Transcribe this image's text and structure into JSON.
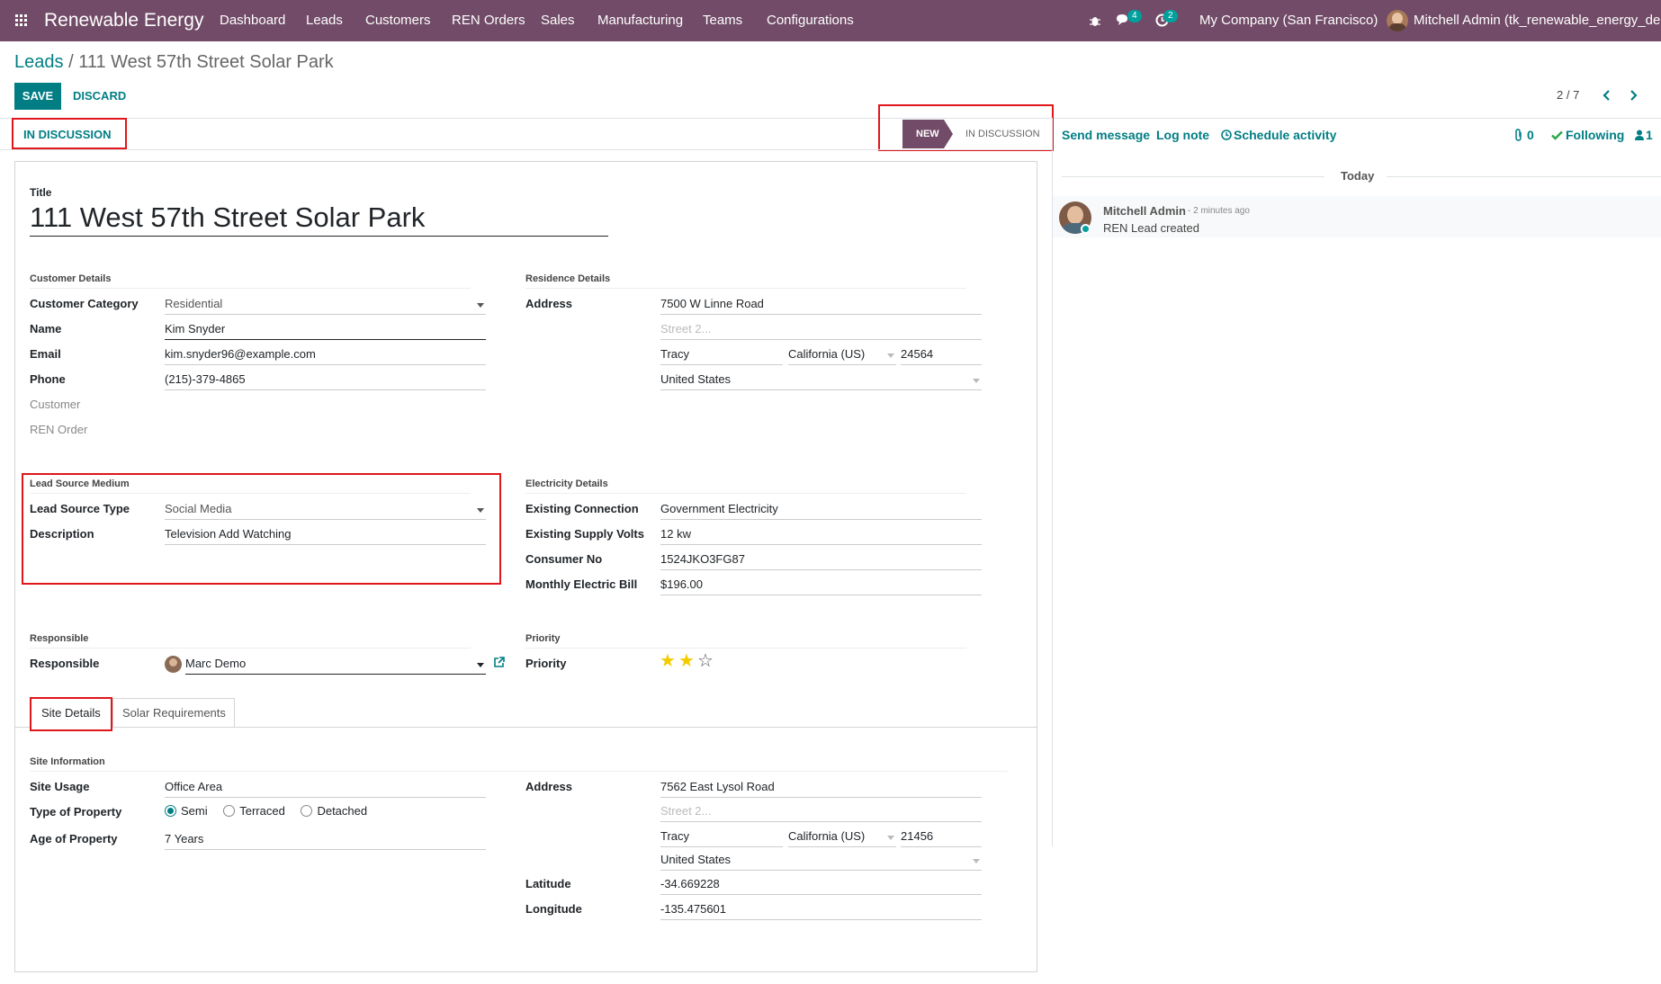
{
  "nav": {
    "app_name": "Renewable Energy",
    "menu": [
      "Dashboard",
      "Leads",
      "Customers",
      "REN Orders",
      "Sales",
      "Manufacturing",
      "Teams",
      "Configurations"
    ],
    "messages_count": "4",
    "activities_count": "2",
    "company": "My Company (San Francisco)",
    "user": "Mitchell Admin (tk_renewable_energy_demo)"
  },
  "breadcrumb": {
    "parent": "Leads",
    "separator": "/",
    "current": "111 West 57th Street Solar Park"
  },
  "toolbar": {
    "save_label": "SAVE",
    "discard_label": "DISCARD",
    "pager": "2 / 7"
  },
  "status": {
    "current_label": "IN DISCUSSION",
    "stages": [
      "NEW",
      "IN DISCUSSION"
    ],
    "active_stage": "NEW"
  },
  "form": {
    "title_label": "Title",
    "title": "111 West 57th Street Solar Park",
    "customer_details": {
      "section": "Customer Details",
      "category_label": "Customer Category",
      "category": "Residential",
      "name_label": "Name",
      "name": "Kim Snyder",
      "email_label": "Email",
      "email": "kim.snyder96@example.com",
      "phone_label": "Phone",
      "phone": "(215)-379-4865",
      "customer_label": "Customer",
      "ren_order_label": "REN Order"
    },
    "residence_details": {
      "section": "Residence Details",
      "address_label": "Address",
      "street": "7500 W Linne Road",
      "street2_placeholder": "Street 2...",
      "city": "Tracy",
      "state": "California (US)",
      "zip": "24564",
      "country": "United States"
    },
    "lead_source": {
      "section": "Lead Source Medium",
      "type_label": "Lead Source Type",
      "type": "Social Media",
      "description_label": "Description",
      "description": "Television Add Watching"
    },
    "electricity": {
      "section": "Electricity Details",
      "connection_label": "Existing Connection",
      "connection": "Government Electricity",
      "volts_label": "Existing Supply Volts",
      "volts": "12 kw",
      "consumer_label": "Consumer No",
      "consumer": "1524JKO3FG87",
      "bill_label": "Monthly Electric Bill",
      "bill": "$196.00"
    },
    "responsible": {
      "section": "Responsible",
      "label": "Responsible",
      "value": "Marc Demo"
    },
    "priority": {
      "section": "Priority",
      "label": "Priority",
      "stars": 2,
      "max": 3
    },
    "tabs": [
      "Site Details",
      "Solar Requirements"
    ],
    "site": {
      "section": "Site Information",
      "usage_label": "Site Usage",
      "usage": "Office Area",
      "type_label": "Type of Property",
      "type_options": [
        "Semi",
        "Terraced",
        "Detached"
      ],
      "type_selected": "Semi",
      "age_label": "Age of Property",
      "age": "7 Years",
      "address_label": "Address",
      "street": "7562 East Lysol Road",
      "street2_placeholder": "Street 2...",
      "city": "Tracy",
      "state": "California (US)",
      "zip": "21456",
      "country": "United States",
      "lat_label": "Latitude",
      "lat": "-34.669228",
      "long_label": "Longitude",
      "long": "-135.475601"
    }
  },
  "chatter": {
    "send_message": "Send message",
    "log_note": "Log note",
    "schedule_activity": "Schedule activity",
    "attachments": "0",
    "following": "Following",
    "followers": "1",
    "date_divider": "Today",
    "messages": [
      {
        "author": "Mitchell Admin",
        "time": "- 2 minutes ago",
        "body": "REN Lead created"
      }
    ]
  },
  "colors": {
    "brand": "#714b67",
    "accent": "#017e84",
    "highlight": "#e0161b",
    "star": "#f3cc00"
  }
}
